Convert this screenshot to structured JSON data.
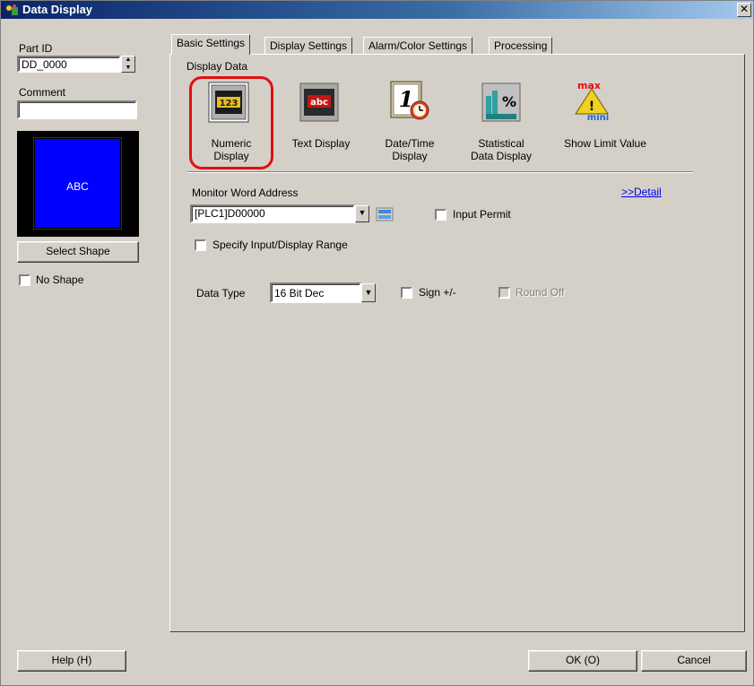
{
  "window": {
    "title": "Data Display",
    "close_glyph": "✕"
  },
  "left_panel": {
    "part_id_label": "Part ID",
    "part_id_value": "DD_0000",
    "comment_label": "Comment",
    "comment_value": "",
    "preview_text": "ABC",
    "select_shape_label": "Select Shape",
    "no_shape_label": "No Shape"
  },
  "tabs": [
    {
      "label": "Basic Settings",
      "active": true
    },
    {
      "label": "Display Settings",
      "active": false
    },
    {
      "label": "Alarm/Color Settings",
      "active": false
    },
    {
      "label": "Processing",
      "active": false
    }
  ],
  "display_data": {
    "group_label": "Display Data",
    "items": [
      {
        "label_1": "Numeric",
        "label_2": "Display",
        "icon": "numeric-display-icon",
        "icon_text": "123",
        "selected": true
      },
      {
        "label_1": "Text Display",
        "label_2": "",
        "icon": "text-display-icon",
        "icon_text": "abc",
        "selected": false
      },
      {
        "label_1": "Date/Time",
        "label_2": "Display",
        "icon": "date-time-icon",
        "icon_text": "1",
        "selected": false
      },
      {
        "label_1": "Statistical",
        "label_2": "Data Display",
        "icon": "statistical-icon",
        "icon_text": "%",
        "selected": false
      },
      {
        "label_1": "Show Limit Value",
        "label_2": "",
        "icon": "limit-value-icon",
        "icon_text_top": "max",
        "icon_text_bottom": "mini",
        "selected": false
      }
    ]
  },
  "monitor": {
    "label": "Monitor Word Address",
    "detail_link": ">>Detail",
    "address_value": "[PLC1]D00000",
    "input_permit_label": "Input Permit",
    "specify_range_label": "Specify Input/Display Range"
  },
  "data_type": {
    "label": "Data Type",
    "value": "16 Bit Dec",
    "sign_label": "Sign +/-",
    "round_off_label": "Round Off"
  },
  "footer": {
    "help_label": "Help (H)",
    "ok_label": "OK (O)",
    "cancel_label": "Cancel"
  },
  "colors": {
    "highlight_ring": "#e01010",
    "preview_fill": "#0000ff",
    "title_bar": "#0a246a"
  }
}
